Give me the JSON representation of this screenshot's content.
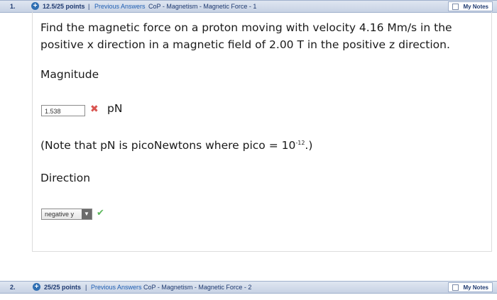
{
  "question1": {
    "number": "1.",
    "points": "12.5/25 points",
    "separator": "|",
    "previous_answers": "Previous Answers",
    "course_title": "CoP - Magnetism - Magnetic Force - 1",
    "my_notes": "My Notes",
    "prompt": "Find the magnetic force on a proton moving with velocity 4.16 Mm/s in the positive x direction in a magnetic field of 2.00 T in the positive z direction.",
    "magnitude_label": "Magnitude",
    "magnitude_value": "1.538",
    "magnitude_unit": "pN",
    "note_text": "(Note that pN is picoNewtons where pico = 10",
    "note_exponent": "-12",
    "note_end": ".)",
    "direction_label": "Direction",
    "direction_selected": "negative y"
  },
  "question2": {
    "number": "2.",
    "points": "25/25 points",
    "separator": "|",
    "previous_answers": "Previous Answers",
    "course_title": "CoP - Magnetism - Magnetic Force - 2",
    "my_notes": "My Notes"
  },
  "colors": {
    "incorrect": "#d9534f",
    "correct": "#5cb85c",
    "header_bg": "#c7d2e4"
  },
  "icons": {
    "expand": "plus-circle-icon",
    "incorrect": "x-icon",
    "correct": "check-icon"
  }
}
